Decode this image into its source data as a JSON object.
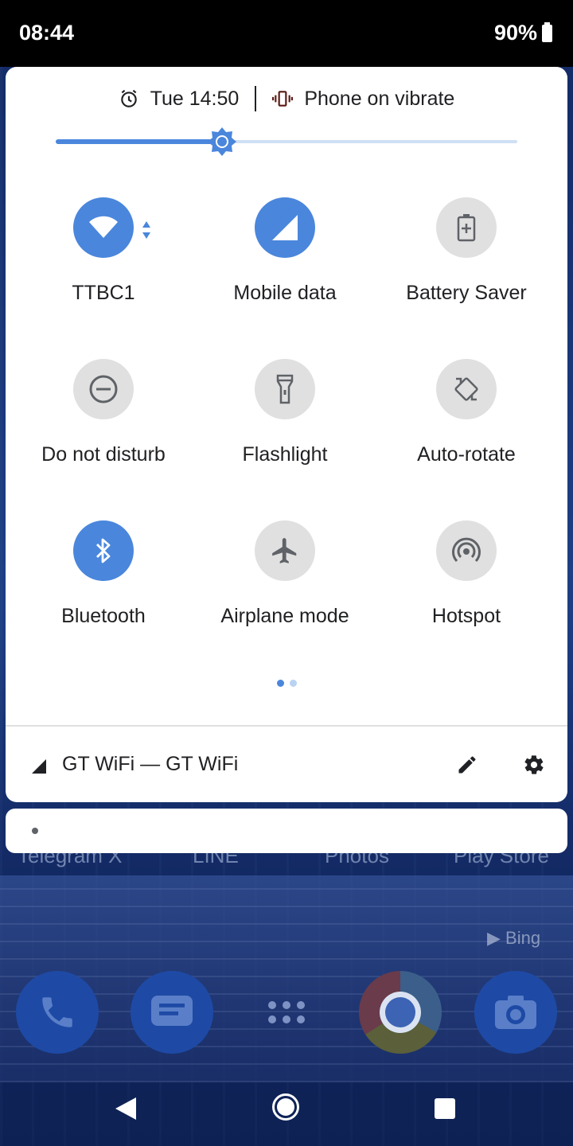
{
  "status_bar": {
    "time": "08:44",
    "battery": "90%"
  },
  "quick_settings": {
    "alarm": "Tue 14:50",
    "ringer": "Phone on vibrate",
    "brightness_level": 0.36,
    "tiles": [
      {
        "label": "TTBC1",
        "icon": "wifi-icon",
        "state": "on"
      },
      {
        "label": "Mobile data",
        "icon": "mobile-data-icon",
        "state": "on"
      },
      {
        "label": "Battery Saver",
        "icon": "battery-saver-icon",
        "state": "off"
      },
      {
        "label": "Do not disturb",
        "icon": "dnd-icon",
        "state": "off"
      },
      {
        "label": "Flashlight",
        "icon": "flashlight-icon",
        "state": "off"
      },
      {
        "label": "Auto-rotate",
        "icon": "auto-rotate-icon",
        "state": "off"
      },
      {
        "label": "Bluetooth",
        "icon": "bluetooth-icon",
        "state": "on"
      },
      {
        "label": "Airplane mode",
        "icon": "airplane-icon",
        "state": "off"
      },
      {
        "label": "Hotspot",
        "icon": "hotspot-icon",
        "state": "off"
      }
    ],
    "pages": {
      "current": 1,
      "total": 2
    },
    "footer_network": "GT WiFi — GT WiFi"
  },
  "home_screen": {
    "app_labels": [
      "Telegram X",
      "LINE",
      "Photos",
      "Play Store"
    ],
    "watermark": "Bing"
  },
  "colors": {
    "accent": "#4a86dc",
    "tile_off": "#e0e0e0",
    "tile_icon_off": "#5f6368",
    "page_dot_inactive": "#b9d3f3"
  }
}
